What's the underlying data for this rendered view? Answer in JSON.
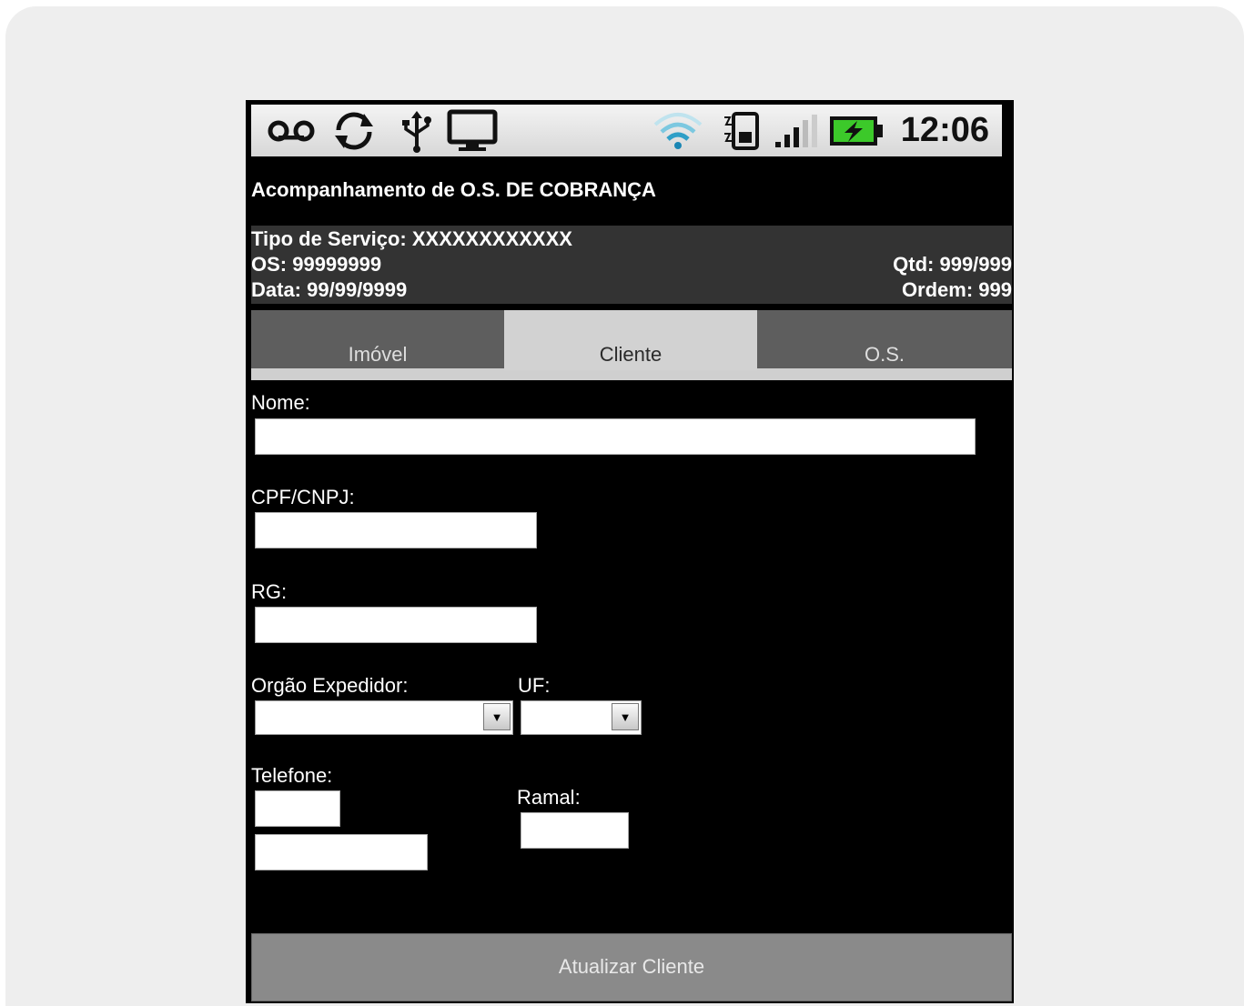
{
  "status_bar": {
    "icons": [
      "voicemail-icon",
      "sync-icon",
      "usb-icon",
      "monitor-icon",
      "wifi-icon",
      "sim-card-icon",
      "signal-icon",
      "battery-charging-icon"
    ],
    "time": "12:06"
  },
  "header": {
    "title": "Acompanhamento de O.S. DE COBRANÇA"
  },
  "info": {
    "tipo_servico": "Tipo de Serviço: XXXXXXXXXXXX",
    "os": "OS: 99999999",
    "data": "Data: 99/99/9999",
    "qtd": "Qtd: 999/999",
    "ordem": "Ordem: 999"
  },
  "tabs": [
    {
      "label": "Imóvel",
      "active": false
    },
    {
      "label": "Cliente",
      "active": true
    },
    {
      "label": "O.S.",
      "active": false
    }
  ],
  "form": {
    "nome_label": "Nome:",
    "nome_value": "",
    "cpf_label": "CPF/CNPJ:",
    "cpf_value": "",
    "rg_label": "RG:",
    "rg_value": "",
    "orgao_label": "Orgão Expedidor:",
    "orgao_value": "",
    "uf_label": "UF:",
    "uf_value": "",
    "telefone_label": "Telefone:",
    "ddd_value": "",
    "telefone_value": "",
    "ramal_label": "Ramal:",
    "ramal_value": ""
  },
  "actions": {
    "update_label": "Atualizar Cliente"
  },
  "colors": {
    "background": "#000000",
    "info_box": "#333333",
    "tab_inactive": "#5e5e5e",
    "tab_active": "#d2d2d2",
    "button": "#8a8a8a",
    "battery_green": "#3cc92a"
  }
}
